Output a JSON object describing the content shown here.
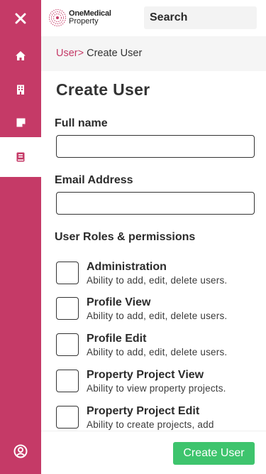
{
  "colors": {
    "brand": "#c53a67",
    "accent_green": "#3ec46d",
    "breadcrumb_bg": "#f5f5f5"
  },
  "sidebar": {
    "items": [
      {
        "icon": "close-icon",
        "active": false
      },
      {
        "icon": "home-icon",
        "active": false
      },
      {
        "icon": "building-icon",
        "active": false
      },
      {
        "icon": "note-icon",
        "active": false
      },
      {
        "icon": "book-icon",
        "active": true
      },
      {
        "icon": "user-circle-icon",
        "active": false
      }
    ]
  },
  "header": {
    "logo_line1": "OneMedical",
    "logo_line2": "Property",
    "search_placeholder": "Search"
  },
  "breadcrumb": {
    "parent": "User>",
    "current": " Create User"
  },
  "form": {
    "title": "Create User",
    "full_name_label": "Full name",
    "full_name_value": "",
    "email_label": "Email Address",
    "email_value": "",
    "roles_label": "User Roles & permissions",
    "roles": [
      {
        "name": "Administration",
        "description": "Ability to add, edit, delete users.",
        "checked": false
      },
      {
        "name": "Profile View",
        "description": "Ability to add, edit, delete users.",
        "checked": false
      },
      {
        "name": "Profile Edit",
        "description": "Ability to add, edit, delete users.",
        "checked": false
      },
      {
        "name": "Property Project View",
        "description": "Ability to view property projects.",
        "checked": false
      },
      {
        "name": "Property Project Edit",
        "description": "Ability to create projects, add",
        "checked": false
      }
    ]
  },
  "footer": {
    "submit_label": "Create User"
  }
}
